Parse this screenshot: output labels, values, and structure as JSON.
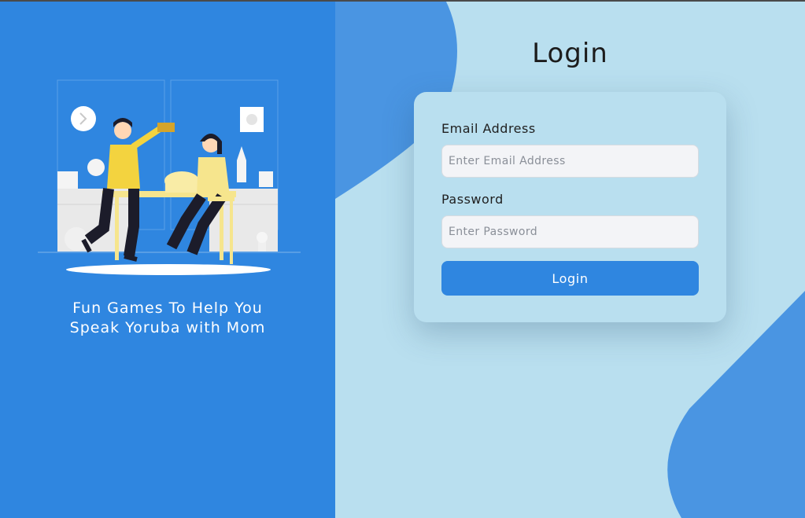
{
  "colors": {
    "accent": "#2f86e0",
    "background": "#b9dfef",
    "shape": "#4a95e2"
  },
  "sidebar": {
    "tagline_line1": "Fun Games To Help You",
    "tagline_line2": "Speak Yoruba with Mom",
    "illustration": "children-playing-game-illustration"
  },
  "login": {
    "title": "Login",
    "email_label": "Email Address",
    "email_placeholder": "Enter Email Address",
    "email_value": "",
    "password_label": "Password",
    "password_placeholder": "Enter Password",
    "password_value": "",
    "submit_label": "Login"
  }
}
